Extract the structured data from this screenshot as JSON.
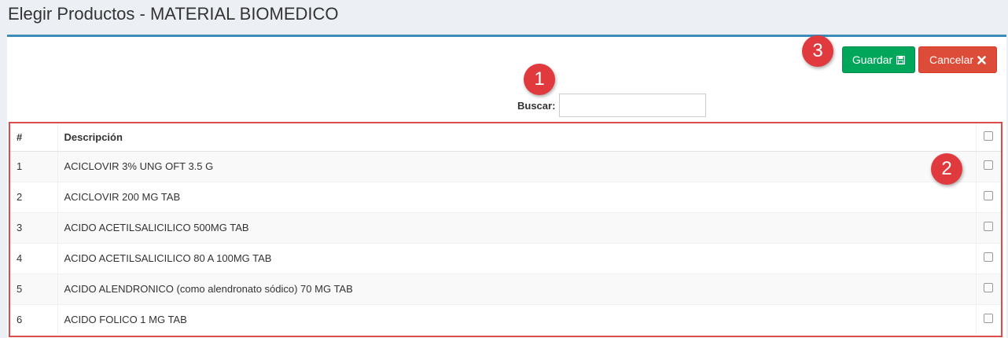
{
  "page": {
    "title": "Elegir Productos - MATERIAL BIOMEDICO"
  },
  "toolbar": {
    "save_label": "Guardar",
    "save_icon": "floppy-disk-icon",
    "cancel_label": "Cancelar",
    "cancel_icon": "close-x-icon"
  },
  "markers": [
    "1",
    "2",
    "3"
  ],
  "search": {
    "label": "Buscar:",
    "value": "",
    "placeholder": ""
  },
  "table": {
    "headers": {
      "num": "#",
      "description": "Descripción"
    },
    "rows": [
      {
        "num": "1",
        "description": "ACICLOVIR 3% UNG OFT 3.5 G",
        "checked": false
      },
      {
        "num": "2",
        "description": "ACICLOVIR 200 MG TAB",
        "checked": false
      },
      {
        "num": "3",
        "description": "ACIDO ACETILSALICILICO 500MG TAB",
        "checked": false
      },
      {
        "num": "4",
        "description": "ACIDO ACETILSALICILICO 80 A 100MG TAB",
        "checked": false
      },
      {
        "num": "5",
        "description": "ACIDO ALENDRONICO (como alendronato sódico) 70 MG TAB",
        "checked": false
      },
      {
        "num": "6",
        "description": "ACIDO FOLICO 1 MG TAB",
        "checked": false
      }
    ]
  },
  "colors": {
    "accent": "#3c8dbc",
    "save": "#00a65a",
    "cancel": "#dd4b39",
    "marker": "#e0393e",
    "highlight_frame": "#dd4b4b"
  }
}
